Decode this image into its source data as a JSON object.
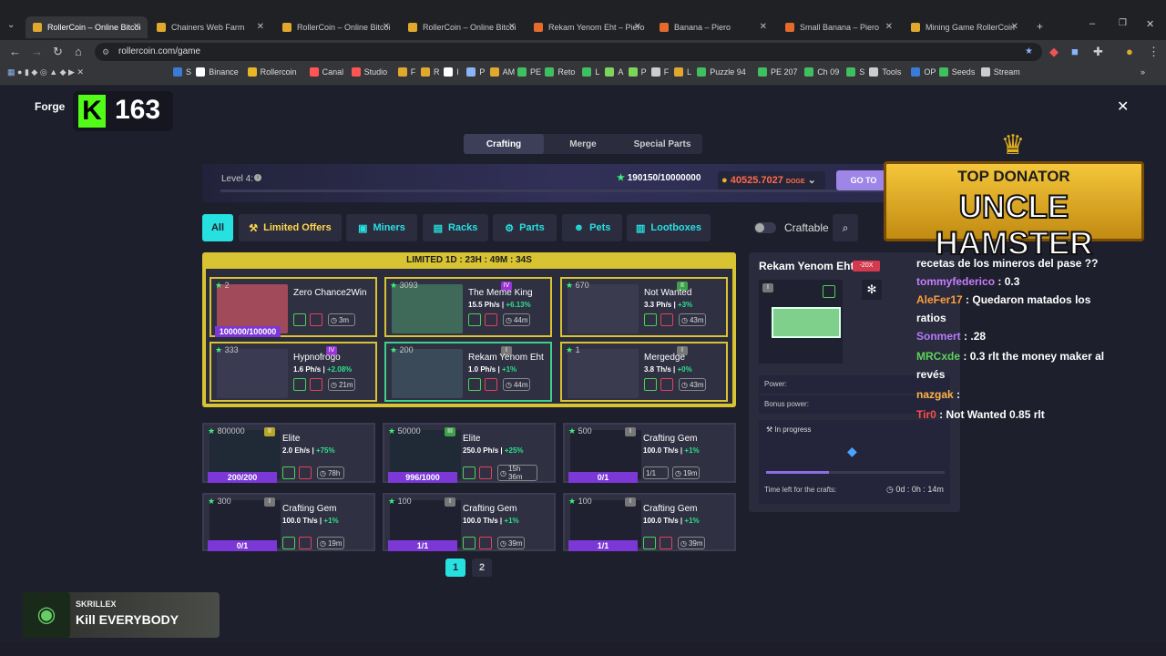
{
  "browser": {
    "tabs": [
      "RollerCoin – Online Bitcoi",
      "Chainers Web Farm",
      "RollerCoin – Online Bitcoi",
      "RollerCoin – Online Bitcoi",
      "Rekam Yenom Eht – Piero",
      "Banana – Piero",
      "Small Banana – Piero",
      "Mining Game RollerCoin"
    ],
    "url": "rollercoin.com/game",
    "bookmarks": [
      "S",
      "Binance",
      "Rollercoin",
      "Canal",
      "Studio",
      "F",
      "R",
      "I",
      "P",
      "AM",
      "PE",
      "Reto",
      "L",
      "A",
      "P",
      "F",
      "L",
      "Puzzle 94",
      "PE 207",
      "Ch 09",
      "S",
      "Tools",
      "OP",
      "Seeds",
      "Stream"
    ]
  },
  "forge": {
    "title": "Forge",
    "count": "163",
    "tabs": [
      "Crafting",
      "Merge",
      "Special Parts"
    ]
  },
  "banner": {
    "level": "Level 4:",
    "progress": "190150/10000000",
    "balance": "40525.7027",
    "currency": "DOGE",
    "go_button": "GO TO"
  },
  "categories": [
    "All",
    "Limited Offers",
    "Miners",
    "Racks",
    "Parts",
    "Pets",
    "Lootboxes"
  ],
  "craftable_label": "Craftable",
  "limited_timer": "LIMITED 1D : 23H : 49M : 34S",
  "limited_items": [
    {
      "stars": "2",
      "name": "Zero Chance2Win",
      "power": "",
      "bonus": "",
      "time": "3m",
      "badge": "100000/100000",
      "level": ""
    },
    {
      "stars": "3093",
      "name": "The Meme King",
      "power": "15.5 Ph/s |",
      "bonus": "+6.13%",
      "time": "44m",
      "badge": "",
      "level": "IV"
    },
    {
      "stars": "670",
      "name": "Not Wanted",
      "power": "3.3 Ph/s |",
      "bonus": "+3%",
      "time": "43m",
      "badge": "",
      "level": "II"
    },
    {
      "stars": "333",
      "name": "Hypnofrogo",
      "power": "1.6 Ph/s |",
      "bonus": "+2.08%",
      "time": "21m",
      "badge": "",
      "level": "IV"
    },
    {
      "stars": "200",
      "name": "Rekam Yenom Eht",
      "power": "1.0 Ph/s |",
      "bonus": "+1%",
      "time": "44m",
      "badge": "",
      "level": "I"
    },
    {
      "stars": "1",
      "name": "Mergedge",
      "power": "3.8 Th/s |",
      "bonus": "+0%",
      "time": "43m",
      "badge": "",
      "level": "I"
    }
  ],
  "regular_items": [
    {
      "stars": "800000",
      "name": "Elite",
      "power": "2.0 Eh/s |",
      "bonus": "+75%",
      "time": "78h",
      "badge": "200/200",
      "level": "II"
    },
    {
      "stars": "50000",
      "name": "Elite",
      "power": "250.0 Ph/s |",
      "bonus": "+25%",
      "time": "15h 36m",
      "badge": "996/1000",
      "level": "III"
    },
    {
      "stars": "500",
      "name": "Crafting Gem",
      "power": "100.0 Th/s |",
      "bonus": "+1%",
      "time": "19m",
      "badge": "0/1",
      "level": "I",
      "extra": "1/1"
    },
    {
      "stars": "300",
      "name": "Crafting Gem",
      "power": "100.0 Th/s |",
      "bonus": "+1%",
      "time": "19m",
      "badge": "0/1",
      "level": "I"
    },
    {
      "stars": "100",
      "name": "Crafting Gem",
      "power": "100.0 Th/s |",
      "bonus": "+1%",
      "time": "39m",
      "badge": "1/1",
      "level": "I"
    },
    {
      "stars": "100",
      "name": "Crafting Gem",
      "power": "100.0 Th/s |",
      "bonus": "+1%",
      "time": "39m",
      "badge": "1/1",
      "level": "I"
    }
  ],
  "pagination": [
    "1",
    "2"
  ],
  "detail": {
    "title": "Rekam Yenom Eht",
    "tag": "-20X",
    "level": "I",
    "power_label": "Power:",
    "bonus_label": "Bonus power:",
    "in_progress": "In progress",
    "progress": 0.35,
    "time_left_label": "Time left for the crafts:",
    "time_left": "0d : 0h : 14m"
  },
  "overlay": {
    "top": "TOP DONATOR",
    "name": "UNCLE HAMSTER"
  },
  "chat": [
    {
      "user": "",
      "text": "recetas de los mineros del pase ??",
      "color": "#ffffff"
    },
    {
      "user": "tommyfederico",
      "text": ": 0.3",
      "color": "#c77dff"
    },
    {
      "user": "AleFer17",
      "text": ": Quedaron matados los",
      "color": "#ff9e3d"
    },
    {
      "user": "",
      "text": "ratios",
      "color": "#ffffff"
    },
    {
      "user": "Sonmert",
      "text": ": .28",
      "color": "#b57bff"
    },
    {
      "user": "MRCxde",
      "text": ": 0.3 rlt the money maker al",
      "color": "#5cd35c"
    },
    {
      "user": "",
      "text": "revés",
      "color": "#ffffff"
    },
    {
      "user": "nazgak",
      "text": ":",
      "color": "#ffb347"
    },
    {
      "user": "Tir0",
      "text": ": Not Wanted 0.85 rlt",
      "color": "#ff4b4b"
    }
  ],
  "music": {
    "artist": "SKRILLEX",
    "track": "Kill EVERYBODY"
  }
}
